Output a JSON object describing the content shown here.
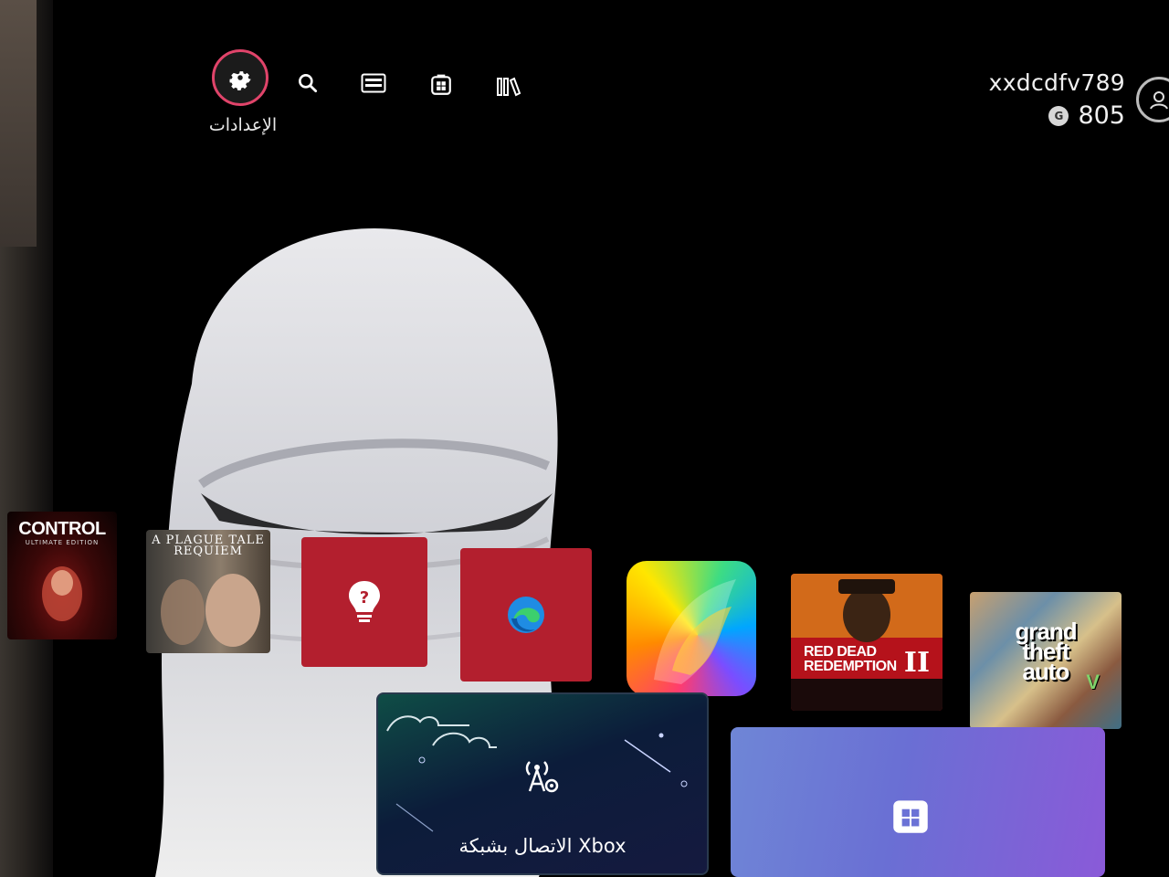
{
  "header": {
    "nav": [
      {
        "name": "settings",
        "label": "الإعدادات",
        "icon": "gear-icon",
        "selected": true
      },
      {
        "name": "search",
        "icon": "search-icon"
      },
      {
        "name": "game-pass",
        "icon": "game-pass-icon"
      },
      {
        "name": "store",
        "icon": "store-icon"
      },
      {
        "name": "library",
        "icon": "library-icon"
      }
    ],
    "accent_color": "#e0446a"
  },
  "user": {
    "gamertag": "xxdcdfv789",
    "gamerscore": "805",
    "gamerscore_icon": "G",
    "profile_icon": "person-icon"
  },
  "tiles": {
    "control": {
      "title": "CONTROL",
      "subtitle": "ULTIMATE EDITION"
    },
    "plague": {
      "title_line1": "A PLAGUE TALE",
      "title_line2": "REQUIEM"
    },
    "tips": {
      "icon": "lightbulb-question-icon",
      "color": "#b31f2e"
    },
    "edge": {
      "icon": "edge-browser-icon",
      "color": "#b31f2e"
    },
    "paint": {
      "icon": "paint-app-icon"
    },
    "rdr": {
      "title_line1": "RED DEAD",
      "title_line2": "REDEMPTION",
      "numeral": "II"
    },
    "gta": {
      "title_line1": "grand",
      "title_line2": "theft",
      "title_line3": "auto",
      "numeral": "V"
    }
  },
  "cards": {
    "network": {
      "label": "الاتصال بشبكة Xbox",
      "icon": "network-settings-icon"
    },
    "store": {
      "icon": "store-icon"
    }
  }
}
